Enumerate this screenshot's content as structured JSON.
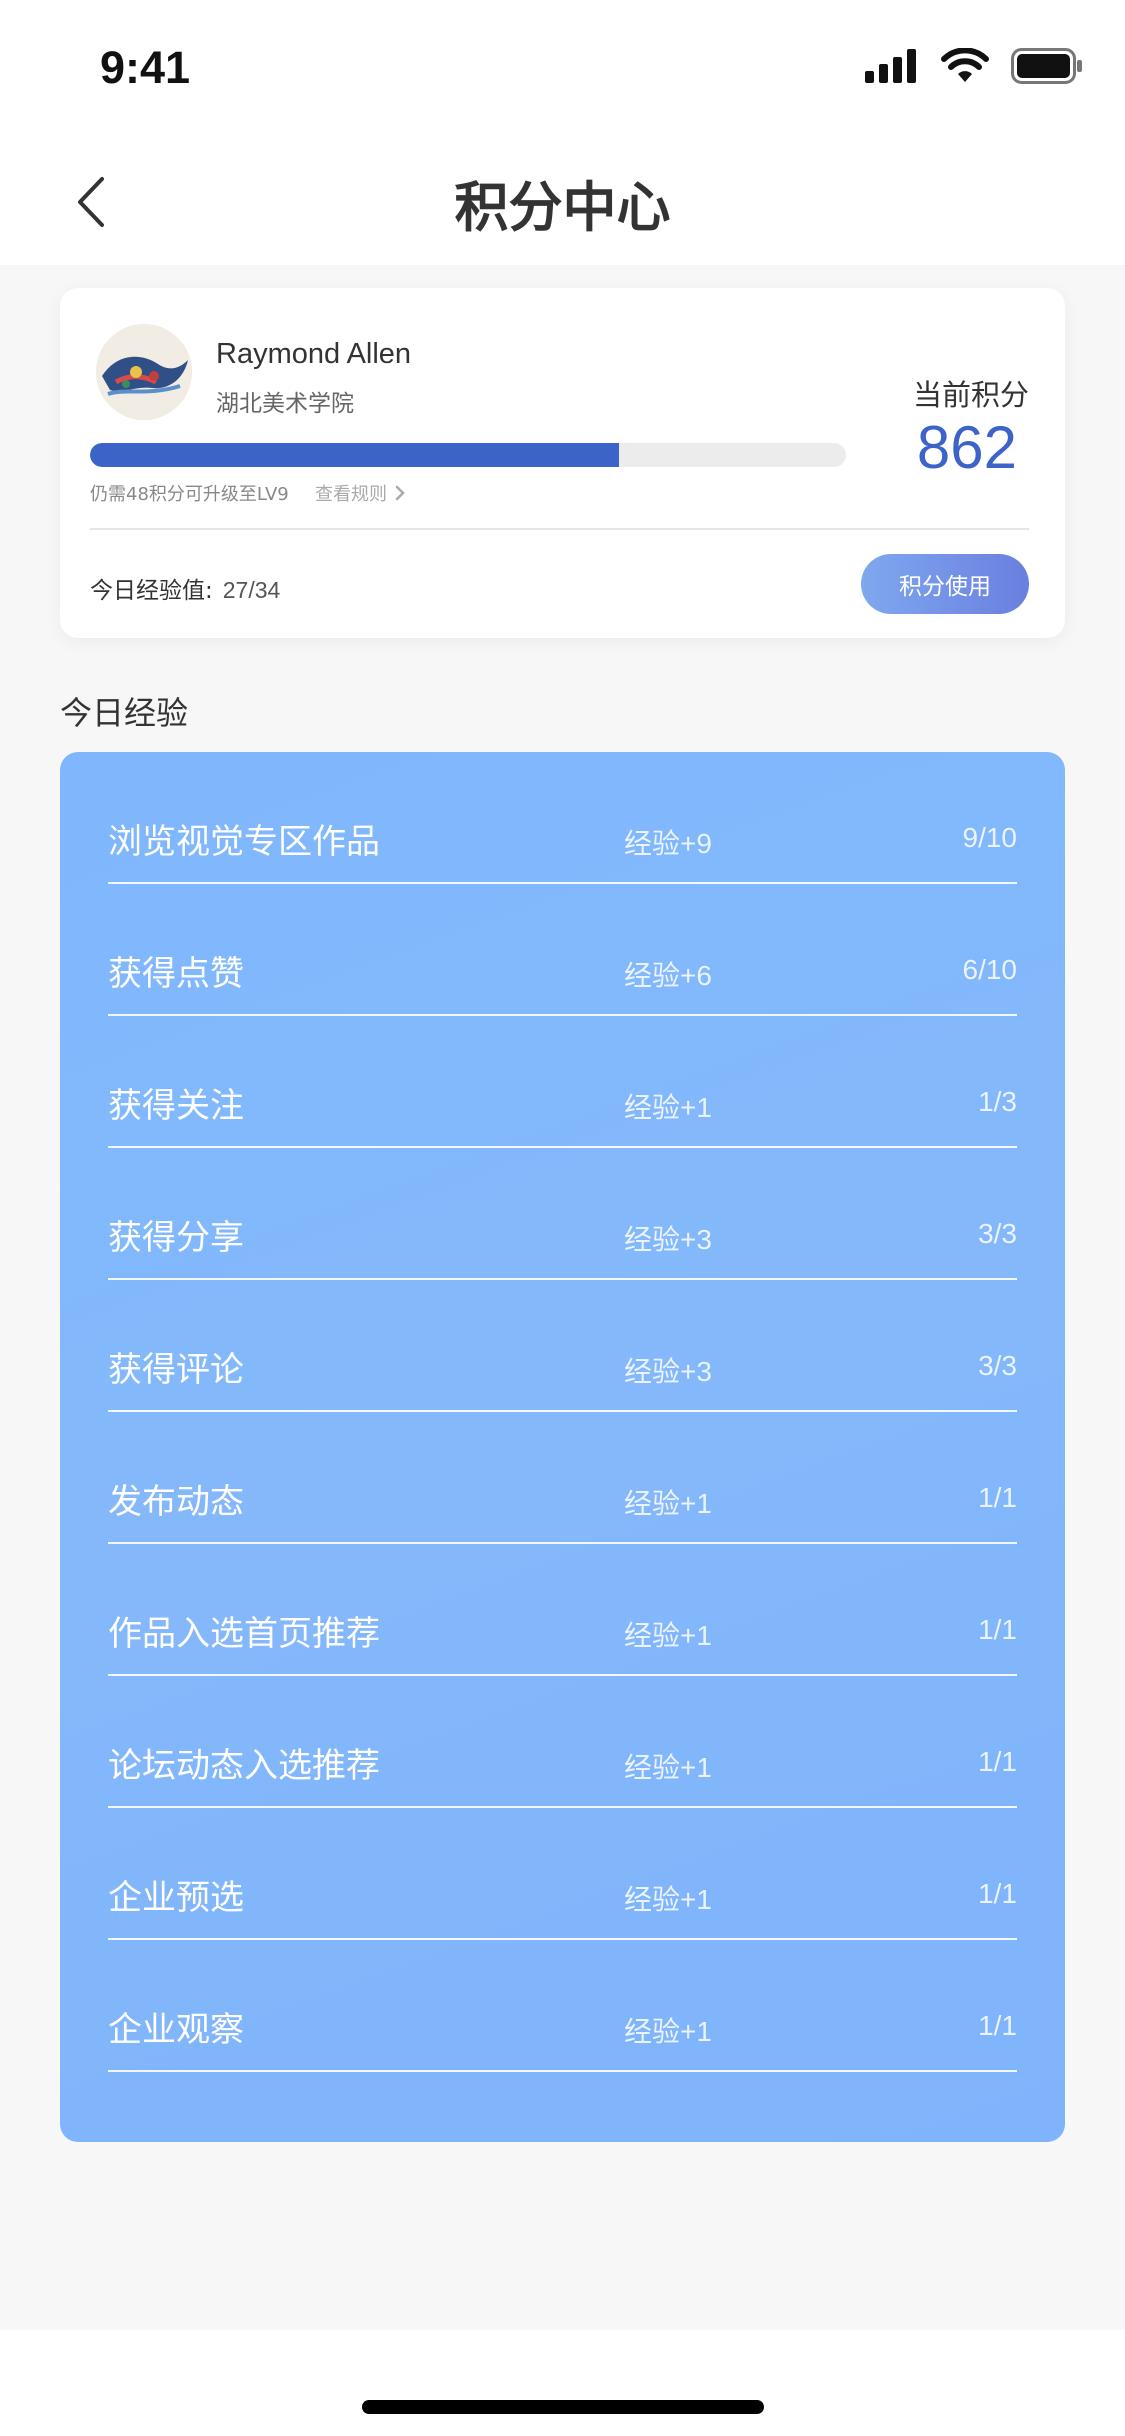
{
  "status_bar": {
    "time": "9:41"
  },
  "header": {
    "title": "积分中心"
  },
  "profile": {
    "name": "Raymond Allen",
    "school": "湖北美术学院",
    "level_progress": 0.7,
    "upgrade_hint": "仍需48积分可升级至LV9",
    "rules_link": "查看规则",
    "points_label": "当前积分",
    "points_value": "862",
    "today_exp_label": "今日经验值:",
    "today_exp_value": "27/34",
    "use_points_label": "积分使用"
  },
  "section": {
    "title": "今日经验"
  },
  "tasks": [
    {
      "name": "浏览视觉专区作品",
      "reward": "经验+9",
      "progress": "9/10"
    },
    {
      "name": "获得点赞",
      "reward": "经验+6",
      "progress": "6/10"
    },
    {
      "name": "获得关注",
      "reward": "经验+1",
      "progress": "1/3"
    },
    {
      "name": "获得分享",
      "reward": "经验+3",
      "progress": "3/3"
    },
    {
      "name": "获得评论",
      "reward": "经验+3",
      "progress": "3/3"
    },
    {
      "name": "发布动态",
      "reward": "经验+1",
      "progress": "1/1"
    },
    {
      "name": "作品入选首页推荐",
      "reward": "经验+1",
      "progress": "1/1"
    },
    {
      "name": "论坛动态入选推荐",
      "reward": "经验+1",
      "progress": "1/1"
    },
    {
      "name": "企业预选",
      "reward": "经验+1",
      "progress": "1/1"
    },
    {
      "name": "企业观察",
      "reward": "经验+1",
      "progress": "1/1"
    }
  ],
  "colors": {
    "accent": "#3c64c8",
    "panel": "#82b6fb"
  },
  "icons": [
    "signal-icon",
    "wifi-icon",
    "battery-icon",
    "back-arrow-icon",
    "chevron-right-icon"
  ]
}
